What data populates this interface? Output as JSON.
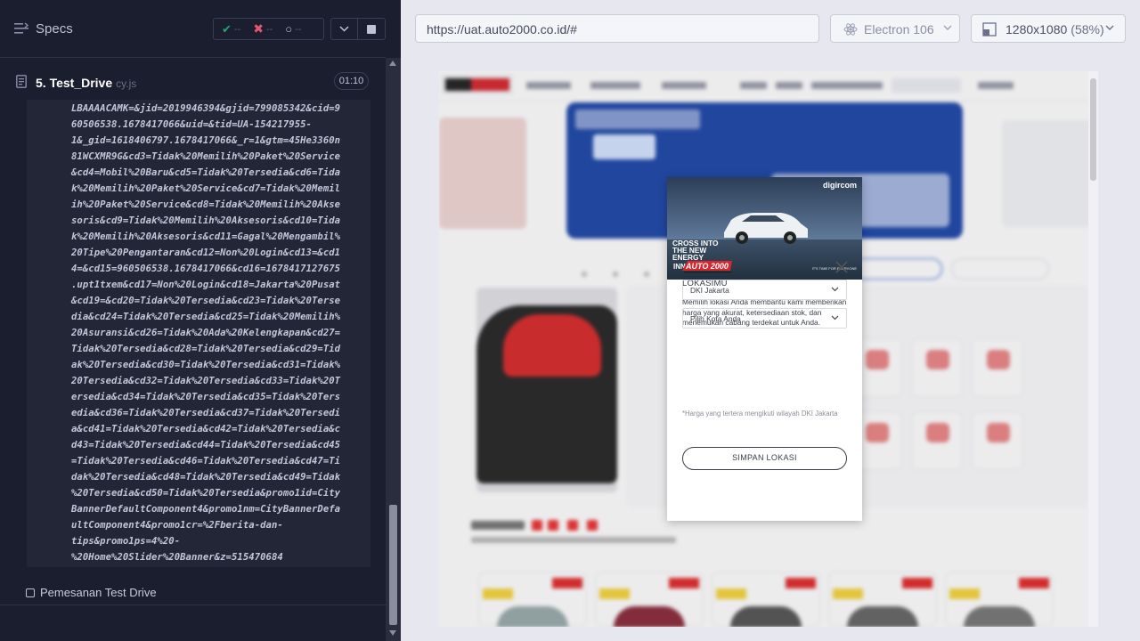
{
  "runner": {
    "title": "Specs",
    "stats": {
      "passed": "--",
      "failed": "--",
      "pending": "--"
    },
    "spec": {
      "name": "5. Test_Drive",
      "ext": "cy.js",
      "duration": "01:10"
    },
    "log_lines": [
      "LBAAAACAMK=&jid=2019946394&gjid=799085342&cid=9",
      "60506538.1678417066&uid=&tid=UA-154217955-",
      "1&_gid=1618406797.1678417066&_r=1&gtm=45He3360n",
      "81WCXMR9G&cd3=Tidak%20Memilih%20Paket%20Service",
      "&cd4=Mobil%20Baru&cd5=Tidak%20Tersedia&cd6=Tida",
      "k%20Memilih%20Paket%20Service&cd7=Tidak%20Memil",
      "ih%20Paket%20Service&cd8=Tidak%20Memilih%20Akse",
      "soris&cd9=Tidak%20Memilih%20Aksesoris&cd10=Tida",
      "k%20Memilih%20Aksesoris&cd11=Gagal%20Mengambil%",
      "20Tipe%20Pengantaran&cd12=Non%20Login&cd13=&cd1",
      "4=&cd15=960506538.1678417066&cd16=1678417127675",
      ".upt1txem&cd17=Non%20Login&cd18=Jakarta%20Pusat",
      "&cd19=&cd20=Tidak%20Tersedia&cd23=Tidak%20Terse",
      "dia&cd24=Tidak%20Tersedia&cd25=Tidak%20Memilih%",
      "20Asuransi&cd26=Tidak%20Ada%20Kelengkapan&cd27=",
      "Tidak%20Tersedia&cd28=Tidak%20Tersedia&cd29=Tid",
      "ak%20Tersedia&cd30=Tidak%20Tersedia&cd31=Tidak%",
      "20Tersedia&cd32=Tidak%20Tersedia&cd33=Tidak%20T",
      "ersedia&cd34=Tidak%20Tersedia&cd35=Tidak%20Ters",
      "edia&cd36=Tidak%20Tersedia&cd37=Tidak%20Tersedi",
      "a&cd41=Tidak%20Tersedia&cd42=Tidak%20Tersedia&c",
      "d43=Tidak%20Tersedia&cd44=Tidak%20Tersedia&cd45",
      "=Tidak%20Tersedia&cd46=Tidak%20Tersedia&cd47=Ti",
      "dak%20Tersedia&cd48=Tidak%20Tersedia&cd49=Tidak",
      "%20Tersedia&cd50=Tidak%20Tersedia&promo1id=City",
      "BannerDefaultComponent4&promo1nm=CityBannerDefa",
      "ultComponent4&promo1cr=%2Fberita-dan-",
      "tips&promo1ps=4%20-",
      "%20Home%20Slider%20Banner&z=515470684"
    ],
    "test_item": "Pemesanan Test Drive"
  },
  "aut": {
    "url": "https://uat.auto2000.co.id/#",
    "browser": "Electron 106",
    "viewport": "1280x1080",
    "scale": "(58%)"
  },
  "modal": {
    "banner": {
      "brand": "digircom",
      "headline": "CROSS INTO THE NEW ENERGY",
      "model": "INNOVA",
      "tagline": "IT'S TIME FOR EVERYONE"
    },
    "logo_text": "AUTO 2000",
    "title": "LOKASIMU",
    "description": "Memilih lokasi Anda membantu kami memberikan harga yang akurat, ketersediaan stok, dan menemukan cabang terdekat untuk Anda.",
    "province_value": "DKI Jakarta",
    "city_placeholder": "Pilih Kota Anda",
    "note": "*Harga yang tertera mengikuti wilayah DKI Jakarta",
    "save_label": "SIMPAN LOKASI"
  },
  "colors": {
    "runner_bg": "#1b1e2e",
    "pass": "#1fa971",
    "fail": "#e45770",
    "aut_bg": "#e6e7ef",
    "brand_red": "#d7262d"
  }
}
